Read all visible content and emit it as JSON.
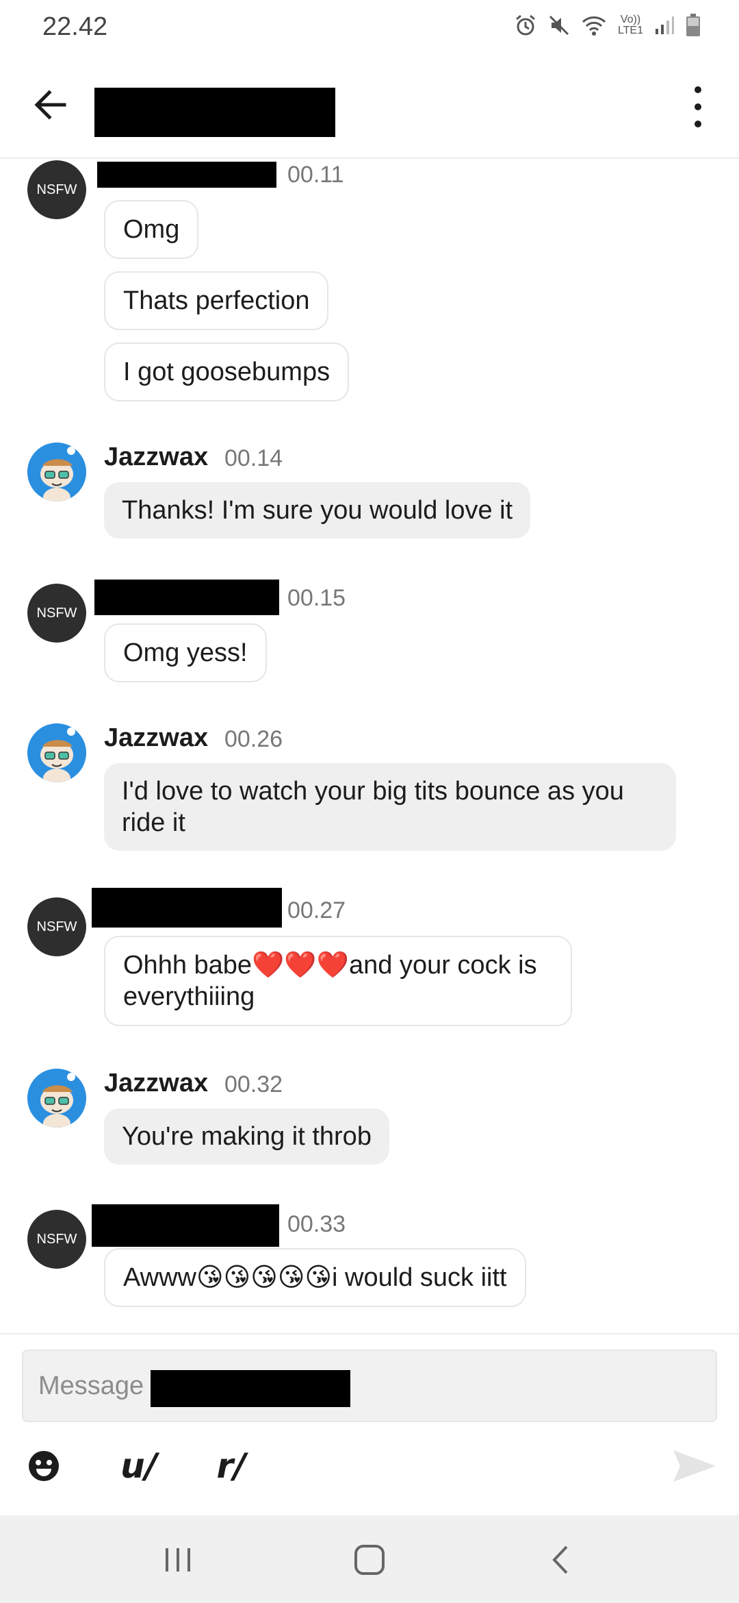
{
  "status_bar": {
    "time": "22.42",
    "network_label": "Vo))\nLTE1"
  },
  "header": {
    "title": ""
  },
  "messages": [
    {
      "sender": "",
      "avatar_label": "NSFW",
      "time": "00.11",
      "bubbles": [
        "Omg",
        "Thats perfection",
        "I got goosebumps"
      ]
    },
    {
      "sender": "Jazzwax",
      "time": "00.14",
      "bubbles": [
        "Thanks! I'm sure you would love it"
      ]
    },
    {
      "sender": "",
      "avatar_label": "NSFW",
      "time": "00.15",
      "bubbles": [
        "Omg yess!"
      ]
    },
    {
      "sender": "Jazzwax",
      "time": "00.26",
      "bubbles": [
        "I'd love to watch your big tits bounce as you ride it"
      ]
    },
    {
      "sender": "",
      "avatar_label": "NSFW",
      "time": "00.27",
      "bubbles": [
        "Ohhh babe❤️❤️❤️and your cock is everythiiing"
      ]
    },
    {
      "sender": "Jazzwax",
      "time": "00.32",
      "bubbles": [
        "You're making it throb"
      ]
    },
    {
      "sender": "",
      "avatar_label": "NSFW",
      "time": "00.33",
      "bubbles": [
        "Awww😘😘😘😘😘i would suck iitt"
      ]
    }
  ],
  "composer": {
    "placeholder": "Message",
    "user_mention": "u/",
    "subreddit_mention": "r/"
  },
  "colors": {
    "accent": "#2b8fe0",
    "nsfw_avatar": "#2e2e2e",
    "incoming_bubble": "#efefef"
  }
}
